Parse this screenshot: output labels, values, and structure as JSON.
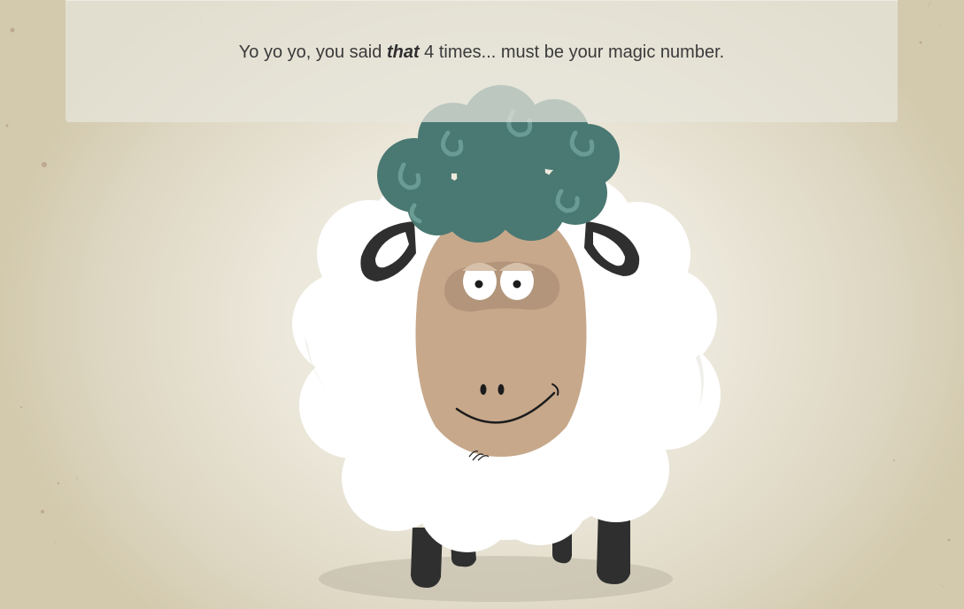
{
  "message": {
    "prefix": "Yo yo yo, you said ",
    "emphasis": "that",
    "count": "4",
    "suffix": " times... must be your magic number."
  },
  "illustration": {
    "name": "sheep-mascot",
    "colors": {
      "background": "#ece8dc",
      "wool": "#ffffff",
      "hair": "#4a7872",
      "face": "#c7a88b",
      "legs": "#2f2f2f"
    }
  }
}
